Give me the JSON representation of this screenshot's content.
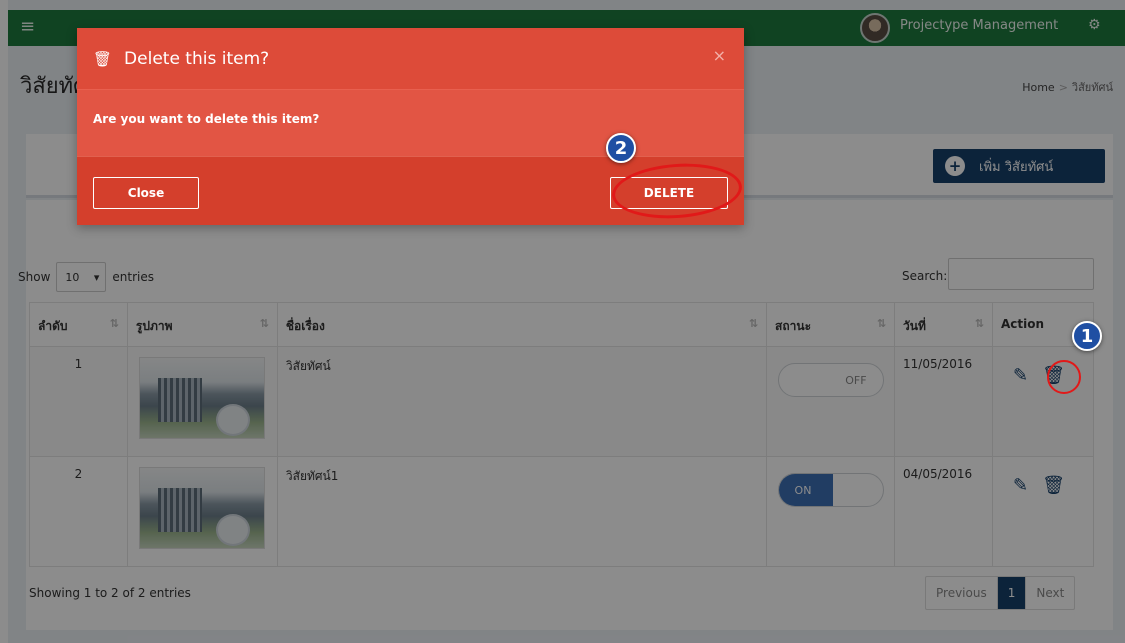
{
  "topbar": {
    "menu_icon": "hamburger-icon",
    "user_name": "Projectype Management",
    "settings_icon": "cogs-icon",
    "brand_color": "#1e7a3f"
  },
  "page": {
    "title": "วิสัยทัศน์",
    "breadcrumb": {
      "home": "Home",
      "current": "วิสัยทัศน์"
    },
    "add_button": "เพิ่ม วิสัยทัศน์"
  },
  "table_controls": {
    "show_label": "Show",
    "length_value": "10",
    "entries_label": "entries",
    "search_label": "Search:",
    "search_value": ""
  },
  "table": {
    "columns": [
      "ลำดับ",
      "รูปภาพ",
      "ชื่อเรื่อง",
      "สถานะ",
      "วันที่",
      "Action"
    ],
    "rows": [
      {
        "no": "1",
        "title": "วิสัยทัศน์",
        "status": "OFF",
        "date": "11/05/2016"
      },
      {
        "no": "2",
        "title": "วิสัยทัศน์1",
        "status": "ON",
        "date": "04/05/2016"
      }
    ]
  },
  "pagination": {
    "info": "Showing 1 to 2 of 2 entries",
    "previous": "Previous",
    "current": "1",
    "next": "Next"
  },
  "modal": {
    "title": "Delete this item?",
    "message": "Are you want to delete this item?",
    "close_x": "×",
    "close_button": "Close",
    "delete_button": "DELETE",
    "color": "#dd4b39"
  },
  "annotations": {
    "step1": "1",
    "step2": "2",
    "ring_color": "#e11919"
  }
}
